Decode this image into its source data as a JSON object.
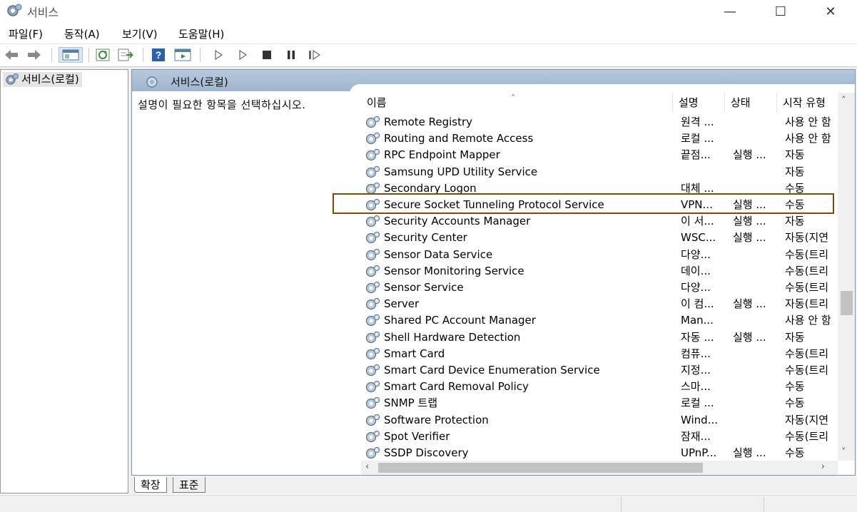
{
  "window": {
    "title": "서비스",
    "minimize_glyph": "—",
    "maximize_glyph": "☐",
    "close_glyph": "✕"
  },
  "menu": [
    {
      "label": "파일(F)"
    },
    {
      "label": "동작(A)"
    },
    {
      "label": "보기(V)"
    },
    {
      "label": "도움말(H)"
    }
  ],
  "toolbar": {
    "icons": [
      "back-arrow-icon",
      "forward-arrow-icon",
      "show-hide-console-tree-icon",
      "refresh-icon",
      "export-list-icon",
      "help-icon",
      "properties-icon",
      "start-service-icon",
      "start-service-alt-icon",
      "stop-service-icon",
      "pause-service-icon",
      "restart-service-icon"
    ]
  },
  "tree": {
    "root_label": "서비스(로컬)"
  },
  "panel": {
    "header_label": "서비스(로컬)",
    "extended_description": "설명이 필요한 항목을 선택하십시오."
  },
  "columns": {
    "name": "이름",
    "description": "설명",
    "status": "상태",
    "startup": "시작 유형",
    "sort_glyph": "˄"
  },
  "rows": [
    {
      "name": "Remote Registry",
      "desc": "원격 ...",
      "status": "",
      "startup": "사용 안 함"
    },
    {
      "name": "Routing and Remote Access",
      "desc": "로컬 ...",
      "status": "",
      "startup": "사용 안 함"
    },
    {
      "name": "RPC Endpoint Mapper",
      "desc": "끝점...",
      "status": "실행 ...",
      "startup": "자동"
    },
    {
      "name": "Samsung UPD Utility Service",
      "desc": "",
      "status": "",
      "startup": "자동"
    },
    {
      "name": "Secondary Logon",
      "desc": "대체 ...",
      "status": "",
      "startup": "수동"
    },
    {
      "name": "Secure Socket Tunneling Protocol Service",
      "desc": "VPN...",
      "status": "실행 ...",
      "startup": "수동"
    },
    {
      "name": "Security Accounts Manager",
      "desc": "이 서...",
      "status": "실행 ...",
      "startup": "자동"
    },
    {
      "name": "Security Center",
      "desc": "WSC...",
      "status": "실행 ...",
      "startup": "자동(지연"
    },
    {
      "name": "Sensor Data Service",
      "desc": "다양...",
      "status": "",
      "startup": "수동(트리"
    },
    {
      "name": "Sensor Monitoring Service",
      "desc": "데이...",
      "status": "",
      "startup": "수동(트리"
    },
    {
      "name": "Sensor Service",
      "desc": "다양...",
      "status": "",
      "startup": "수동(트리"
    },
    {
      "name": "Server",
      "desc": "이 컴...",
      "status": "실행 ...",
      "startup": "자동(트리"
    },
    {
      "name": "Shared PC Account Manager",
      "desc": "Man...",
      "status": "",
      "startup": "사용 안 함"
    },
    {
      "name": "Shell Hardware Detection",
      "desc": "자동 ...",
      "status": "실행 ...",
      "startup": "자동"
    },
    {
      "name": "Smart Card",
      "desc": "컴퓨...",
      "status": "",
      "startup": "수동(트리"
    },
    {
      "name": "Smart Card Device Enumeration Service",
      "desc": "지정...",
      "status": "",
      "startup": "수동(트리"
    },
    {
      "name": "Smart Card Removal Policy",
      "desc": "스마...",
      "status": "",
      "startup": "수동"
    },
    {
      "name": "SNMP 트랩",
      "desc": "로컬 ...",
      "status": "",
      "startup": "수동"
    },
    {
      "name": "Software Protection",
      "desc": "Wind...",
      "status": "",
      "startup": "자동(지연"
    },
    {
      "name": "Spot Verifier",
      "desc": "잠재...",
      "status": "",
      "startup": "수동(트리"
    },
    {
      "name": "SSDP Discovery",
      "desc": "UPnP...",
      "status": "실행 ...",
      "startup": "수동"
    }
  ],
  "highlighted_row": "Secure Socket Tunneling Protocol Service",
  "scrollbars": {
    "up": "˄",
    "down": "˅",
    "left": "‹",
    "right": "›"
  },
  "tabs": {
    "extended": "확장",
    "standard": "표준"
  },
  "colors": {
    "highlight_border": "#7a4a10",
    "panel_header": "#b6c8dc"
  }
}
